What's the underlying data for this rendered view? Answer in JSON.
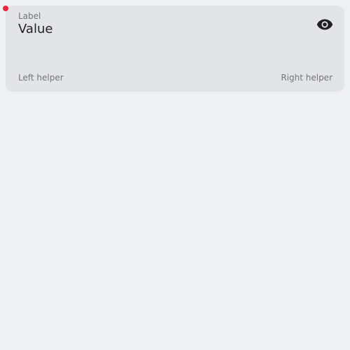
{
  "field": {
    "label": "Label",
    "value": "Value",
    "helper_left": "Left helper",
    "helper_right": "Right helper",
    "visibility_icon": "eye-icon"
  },
  "indicator": {
    "icon": "required-dot",
    "color": "#f0243d"
  }
}
